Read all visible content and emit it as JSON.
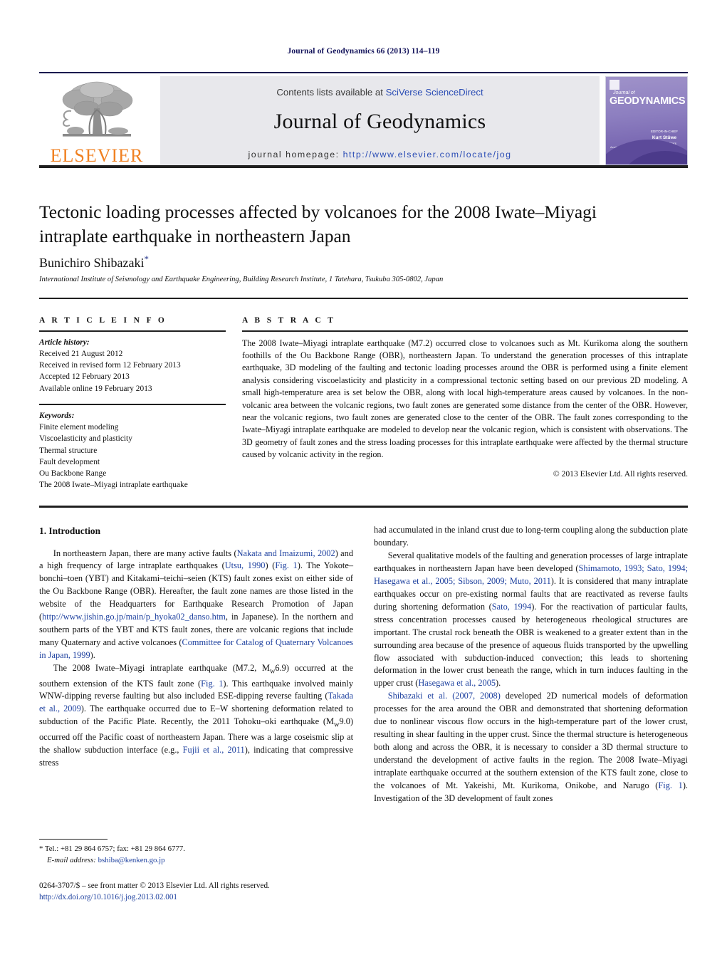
{
  "running_head": "Journal of Geodynamics 66 (2013) 114–119",
  "masthead": {
    "publisher_logo_text": "ELSEVIER",
    "contents_prefix": "Contents lists available at ",
    "contents_link": "SciVerse ScienceDirect",
    "journal_title": "Journal of Geodynamics",
    "homepage_prefix": "journal homepage: ",
    "homepage_link": "http://www.elsevier.com/locate/jog",
    "cover": {
      "sub": "Journal of",
      "title": "GEODYNAMICS",
      "editor_label": "EDITOR-IN-CHIEF",
      "editor_name": "Kurt Stüwe",
      "editor_sub": "associate editors",
      "footer": "Available online at www.sciencedirect.com"
    }
  },
  "article": {
    "title": "Tectonic loading processes affected by volcanoes for the 2008 Iwate–Miyagi intraplate earthquake in northeastern Japan",
    "author": "Bunichiro Shibazaki",
    "author_marker": "*",
    "affiliation": "International Institute of Seismology and Earthquake Engineering, Building Research Institute, 1 Tatehara, Tsukuba 305-0802, Japan"
  },
  "info": {
    "heading": "A R T I C L E   I N F O",
    "history_label": "Article history:",
    "history": [
      "Received 21 August 2012",
      "Received in revised form 12 February 2013",
      "Accepted 12 February 2013",
      "Available online 19 February 2013"
    ],
    "keywords_label": "Keywords:",
    "keywords": [
      "Finite element modeling",
      "Viscoelasticity and plasticity",
      "Thermal structure",
      "Fault development",
      "Ou Backbone Range",
      "The 2008 Iwate–Miyagi intraplate earthquake"
    ]
  },
  "abstract": {
    "heading": "A B S T R A C T",
    "text": "The 2008 Iwate–Miyagi intraplate earthquake (M7.2) occurred close to volcanoes such as Mt. Kurikoma along the southern foothills of the Ou Backbone Range (OBR), northeastern Japan. To understand the generation processes of this intraplate earthquake, 3D modeling of the faulting and tectonic loading processes around the OBR is performed using a finite element analysis considering viscoelasticity and plasticity in a compressional tectonic setting based on our previous 2D modeling. A small high-temperature area is set below the OBR, along with local high-temperature areas caused by volcanoes. In the non-volcanic area between the volcanic regions, two fault zones are generated some distance from the center of the OBR. However, near the volcanic regions, two fault zones are generated close to the center of the OBR. The fault zones corresponding to the Iwate–Miyagi intraplate earthquake are modeled to develop near the volcanic region, which is consistent with observations. The 3D geometry of fault zones and the stress loading processes for this intraplate earthquake were affected by the thermal structure caused by volcanic activity in the region.",
    "copyright": "© 2013 Elsevier Ltd. All rights reserved."
  },
  "body": {
    "section_heading": "1. Introduction",
    "left": {
      "p1": {
        "s1": "In northeastern Japan, there are many active faults (",
        "c1": "Nakata and Imaizumi, 2002",
        "s2": ") and a high frequency of large intraplate earthquakes (",
        "c2": "Utsu, 1990",
        "s3": ") (",
        "c3": "Fig. 1",
        "s4": "). The Yokote–bonchi–toen (YBT) and Kitakami–teichi–seien (KTS) fault zones exist on either side of the Ou Backbone Range (OBR). Hereafter, the fault zone names are those listed in the website of the Headquarters for Earthquake Research Promotion of Japan (",
        "c4": "http://www.jishin.go.jp/main/p_hyoka02_danso.htm",
        "s5": ", in Japanese). In the northern and southern parts of the YBT and KTS fault zones, there are volcanic regions that include many Quaternary and active volcanoes (",
        "c5": "Committee for Catalog of Quaternary Volcanoes in Japan, 1999",
        "s6": ")."
      },
      "p2": {
        "s1": "The 2008 Iwate–Miyagi intraplate earthquake (M7.2, M",
        "sub1": "w",
        "s2": "6.9) occurred at the southern extension of the KTS fault zone (",
        "c1": "Fig. 1",
        "s3": "). This earthquake involved mainly WNW-dipping reverse faulting but also included ESE-dipping reverse faulting (",
        "c2": "Takada et al., 2009",
        "s4": "). The earthquake occurred due to E–W shortening deformation related to subduction of the Pacific Plate. Recently, the 2011 Tohoku–oki earthquake (M",
        "sub2": "w",
        "s5": "9.0) occurred off the Pacific coast of northeastern Japan. There was a large coseismic slip at the shallow subduction interface (e.g., ",
        "c3": "Fujii et al., 2011",
        "s6": "), indicating that compressive stress"
      }
    },
    "right": {
      "p0": "had accumulated in the inland crust due to long-term coupling along the subduction plate boundary.",
      "p1": {
        "s1": "Several qualitative models of the faulting and generation processes of large intraplate earthquakes in northeastern Japan have been developed (",
        "c1": "Shimamoto, 1993; Sato, 1994; Hasegawa et al., 2005; Sibson, 2009; Muto, 2011",
        "s2": "). It is considered that many intraplate earthquakes occur on pre-existing normal faults that are reactivated as reverse faults during shortening deformation (",
        "c2": "Sato, 1994",
        "s3": "). For the reactivation of particular faults, stress concentration processes caused by heterogeneous rheological structures are important. The crustal rock beneath the OBR is weakened to a greater extent than in the surrounding area because of the presence of aqueous fluids transported by the upwelling flow associated with subduction-induced convection; this leads to shortening deformation in the lower crust beneath the range, which in turn induces faulting in the upper crust (",
        "c3": "Hasegawa et al., 2005",
        "s4": ")."
      },
      "p2": {
        "c1": "Shibazaki et al. (2007, 2008)",
        "s1": " developed 2D numerical models of deformation processes for the area around the OBR and demonstrated that shortening deformation due to nonlinear viscous flow occurs in the high-temperature part of the lower crust, resulting in shear faulting in the upper crust. Since the thermal structure is heterogeneous both along and across the OBR, it is necessary to consider a 3D thermal structure to understand the development of active faults in the region. The 2008 Iwate–Miyagi intraplate earthquake occurred at the southern extension of the KTS fault zone, close to the volcanoes of Mt. Yakeishi, Mt. Kurikoma, Onikobe, and Narugo (",
        "c2": "Fig. 1",
        "s2": "). Investigation of the 3D development of fault zones"
      }
    }
  },
  "footnote": {
    "marker": "*",
    "tel": " Tel.: +81 29 864 6757; fax: +81 29 864 6777.",
    "email_label": "E-mail address:",
    "email": "bshiba@kenken.go.jp"
  },
  "imprint": {
    "line1": "0264-3707/$ – see front matter © 2013 Elsevier Ltd. All rights reserved.",
    "doi": "http://dx.doi.org/10.1016/j.jog.2013.02.001"
  }
}
